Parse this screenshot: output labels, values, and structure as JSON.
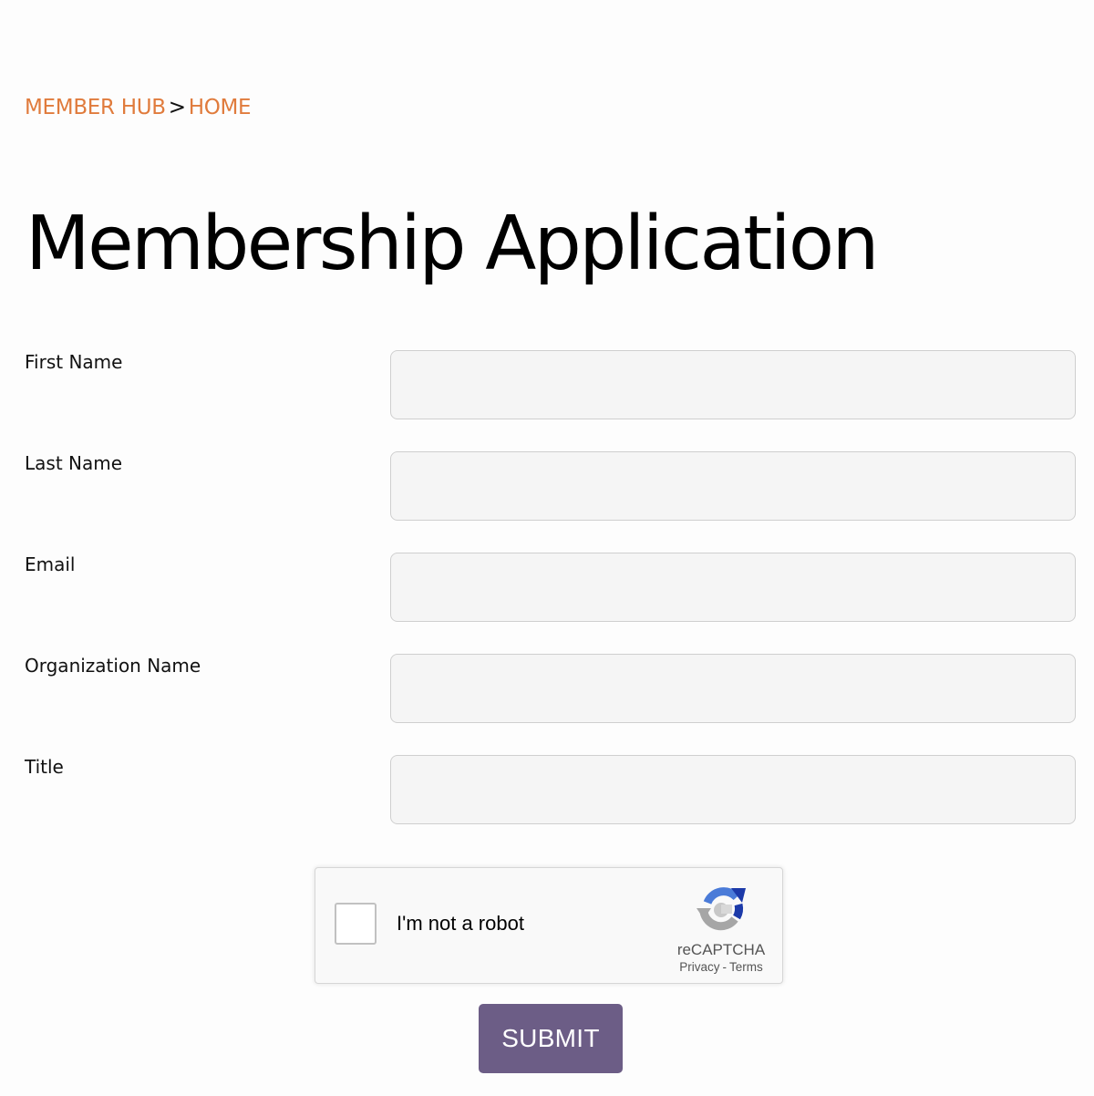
{
  "breadcrumb": {
    "items": [
      {
        "label": "MEMBER HUB"
      },
      {
        "label": "HOME"
      }
    ],
    "separator": ">",
    "link_color": "#e07b3c"
  },
  "page_title": "Membership Application",
  "form": {
    "fields": [
      {
        "label": "First Name",
        "value": "",
        "placeholder": ""
      },
      {
        "label": "Last Name",
        "value": "",
        "placeholder": ""
      },
      {
        "label": "Email",
        "value": "",
        "placeholder": ""
      },
      {
        "label": "Organization Name",
        "value": "",
        "placeholder": ""
      },
      {
        "label": "Title",
        "value": "",
        "placeholder": ""
      }
    ],
    "submit_label": "SUBMIT",
    "submit_color": "#6c5d86"
  },
  "recaptcha": {
    "checkbox_label": "I'm not a robot",
    "brand": "reCAPTCHA",
    "privacy_label": "Privacy",
    "separator": "-",
    "terms_label": "Terms",
    "checked": false,
    "icon": "recaptcha-logo-icon"
  }
}
